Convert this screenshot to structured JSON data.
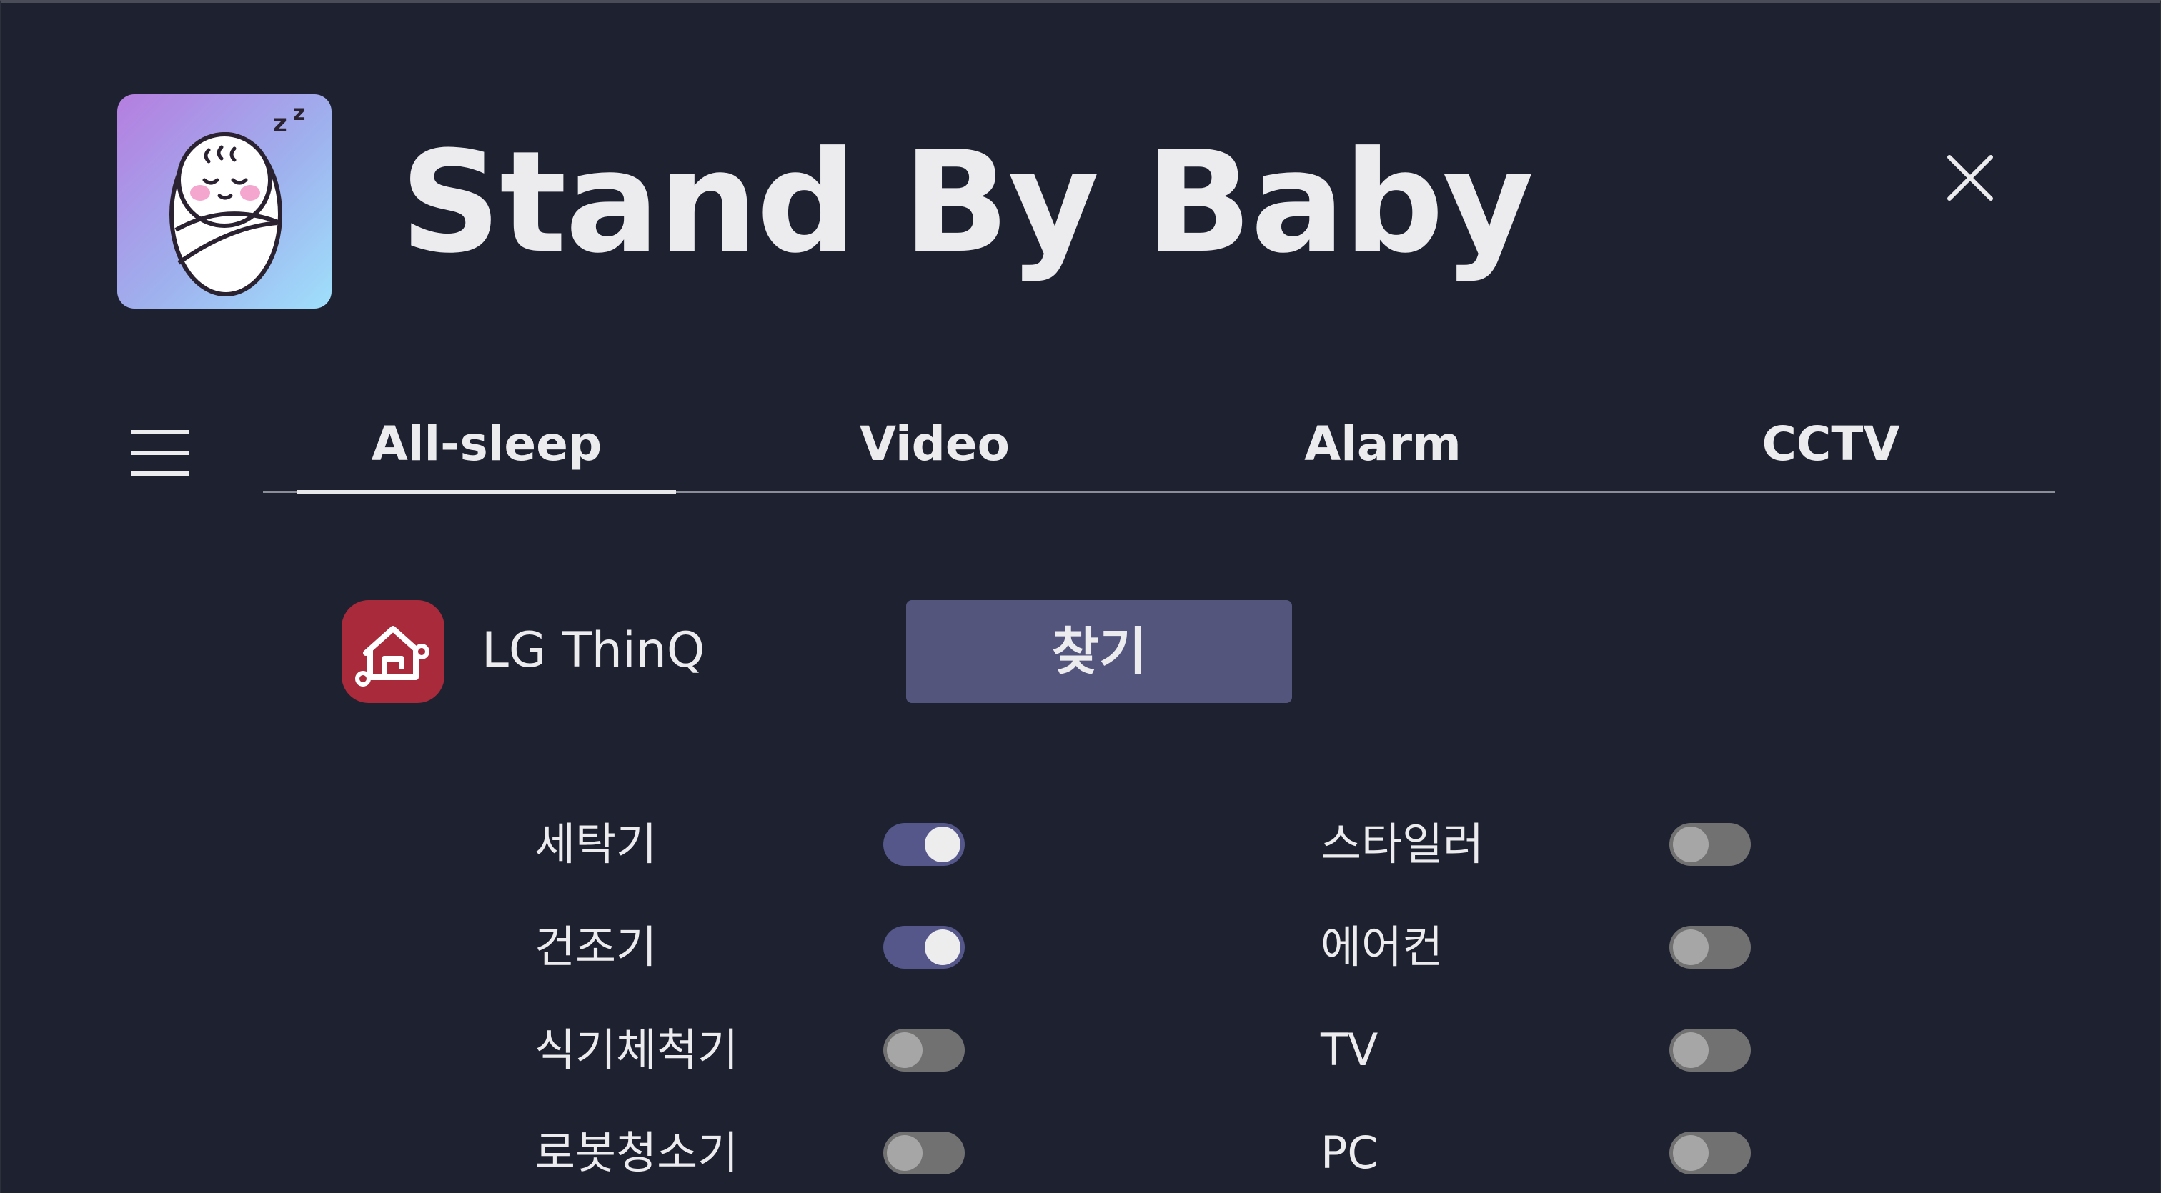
{
  "app": {
    "title": "Stand By Baby",
    "icon": "sleeping-baby-icon",
    "close_icon": "close-icon"
  },
  "nav": {
    "menu_icon": "hamburger-menu-icon",
    "tabs": [
      {
        "label": "All-sleep",
        "active": true
      },
      {
        "label": "Video",
        "active": false
      },
      {
        "label": "Alarm",
        "active": false
      },
      {
        "label": "CCTV",
        "active": false
      }
    ]
  },
  "thinq": {
    "icon": "lg-thinq-home-icon",
    "label": "LG ThinQ",
    "find_button": "찾기"
  },
  "devices": {
    "left": [
      {
        "label": "세탁기",
        "on": true
      },
      {
        "label": "건조기",
        "on": true
      },
      {
        "label": "식기체척기",
        "on": false
      },
      {
        "label": "로봇청소기",
        "on": false
      }
    ],
    "right": [
      {
        "label": "스타일러",
        "on": false
      },
      {
        "label": "에어컨",
        "on": false
      },
      {
        "label": "TV",
        "on": false
      },
      {
        "label": "PC",
        "on": false
      }
    ]
  },
  "colors": {
    "background": "#1e2230",
    "accent": "#53557d",
    "toggle_on": "#55578a",
    "toggle_off": "#717171",
    "thinq_red": "#a92a3b"
  }
}
